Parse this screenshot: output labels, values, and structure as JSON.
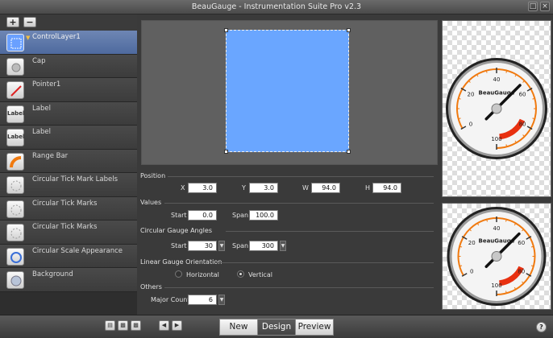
{
  "window": {
    "title": "BeauGauge - Instrumentation Suite Pro v2.3"
  },
  "layers": [
    {
      "label": "ControlLayer1",
      "icon": "control-layer-icon",
      "selected": true
    },
    {
      "label": "Cap",
      "icon": "cap-icon"
    },
    {
      "label": "Pointer1",
      "icon": "pointer-icon"
    },
    {
      "label": "Label",
      "icon": "label-icon",
      "glyph": "Label"
    },
    {
      "label": "Label",
      "icon": "label-icon",
      "glyph": "Label"
    },
    {
      "label": "Range Bar",
      "icon": "range-bar-icon"
    },
    {
      "label": "Circular Tick Mark Labels",
      "icon": "tick-mark-labels-icon"
    },
    {
      "label": "Circular Tick Marks",
      "icon": "tick-marks-icon"
    },
    {
      "label": "Circular Tick Marks",
      "icon": "tick-marks-icon"
    },
    {
      "label": "Circular Scale Appearance",
      "icon": "scale-appearance-icon"
    },
    {
      "label": "Background",
      "icon": "background-icon"
    }
  ],
  "props": {
    "position": {
      "section": "Position",
      "x_label": "X",
      "x": "3.0",
      "y_label": "Y",
      "y": "3.0",
      "w_label": "W",
      "w": "94.0",
      "h_label": "H",
      "h": "94.0"
    },
    "values": {
      "section": "Values",
      "start_label": "Start",
      "start": "0.0",
      "span_label": "Span",
      "span": "100.0"
    },
    "angles": {
      "section": "Circular Gauge Angles",
      "start_label": "Start",
      "start": "30",
      "span_label": "Span",
      "span": "300"
    },
    "orientation": {
      "section": "Linear Gauge Orientation",
      "horizontal": "Horizontal",
      "vertical": "Vertical",
      "selected": "Vertical"
    },
    "others": {
      "section": "Others",
      "major_count_label": "Major Count",
      "major_count": "6"
    }
  },
  "gauge": {
    "brand": "BeauGauge",
    "ticks": [
      "0",
      "20",
      "40",
      "60",
      "80",
      "100"
    ],
    "value": 55,
    "colors": {
      "range": "#f07a10",
      "redzone": "#e83010",
      "face": "#f4f4f4"
    }
  },
  "bottom": {
    "tabs": [
      "New",
      "Design",
      "Preview"
    ],
    "active_tab": "Design",
    "help": "?"
  },
  "colors": {
    "selection": "#6aa6ff",
    "accent": "#4e6a9e"
  }
}
